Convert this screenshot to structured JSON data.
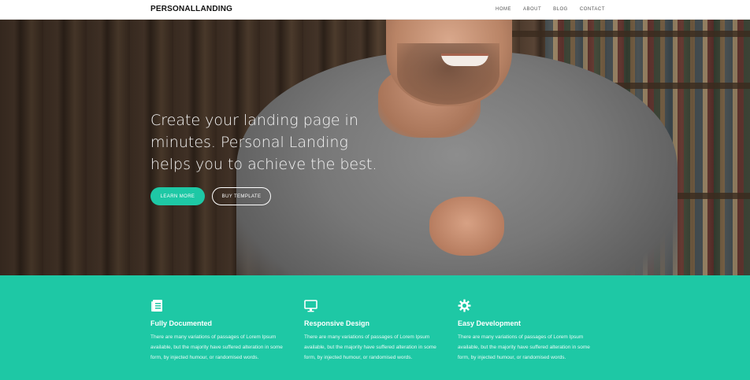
{
  "navbar": {
    "brand": "PERSONALLANDING",
    "links": [
      "HOME",
      "ABOUT",
      "BLOG",
      "CONTACT"
    ]
  },
  "hero": {
    "title_lines": [
      "Create your landing page in",
      "minutes. Personal Landing",
      "helps you to achieve the best."
    ],
    "primary_button": "LEARN MORE",
    "secondary_button": "BUY TEMPLATE"
  },
  "features": [
    {
      "icon": "document-icon",
      "title": "Fully Documented",
      "text": "There are many variations of passages of Lorem Ipsum available, but the majority have suffered alteration in some form, by injected humour, or randomised words."
    },
    {
      "icon": "monitor-icon",
      "title": "Responsive Design",
      "text": "There are many variations of passages of Lorem Ipsum available, but the majority have suffered alteration in some form, by injected humour, or randomised words."
    },
    {
      "icon": "gear-icon",
      "title": "Easy Development",
      "text": "There are many variations of passages of Lorem Ipsum available, but the majority have suffered alteration in some form, by injected humour, or randomised words."
    }
  ],
  "colors": {
    "accent": "#1ec8a5",
    "nav_background": "#ffffff",
    "hero_text": "#f4f4f4"
  }
}
